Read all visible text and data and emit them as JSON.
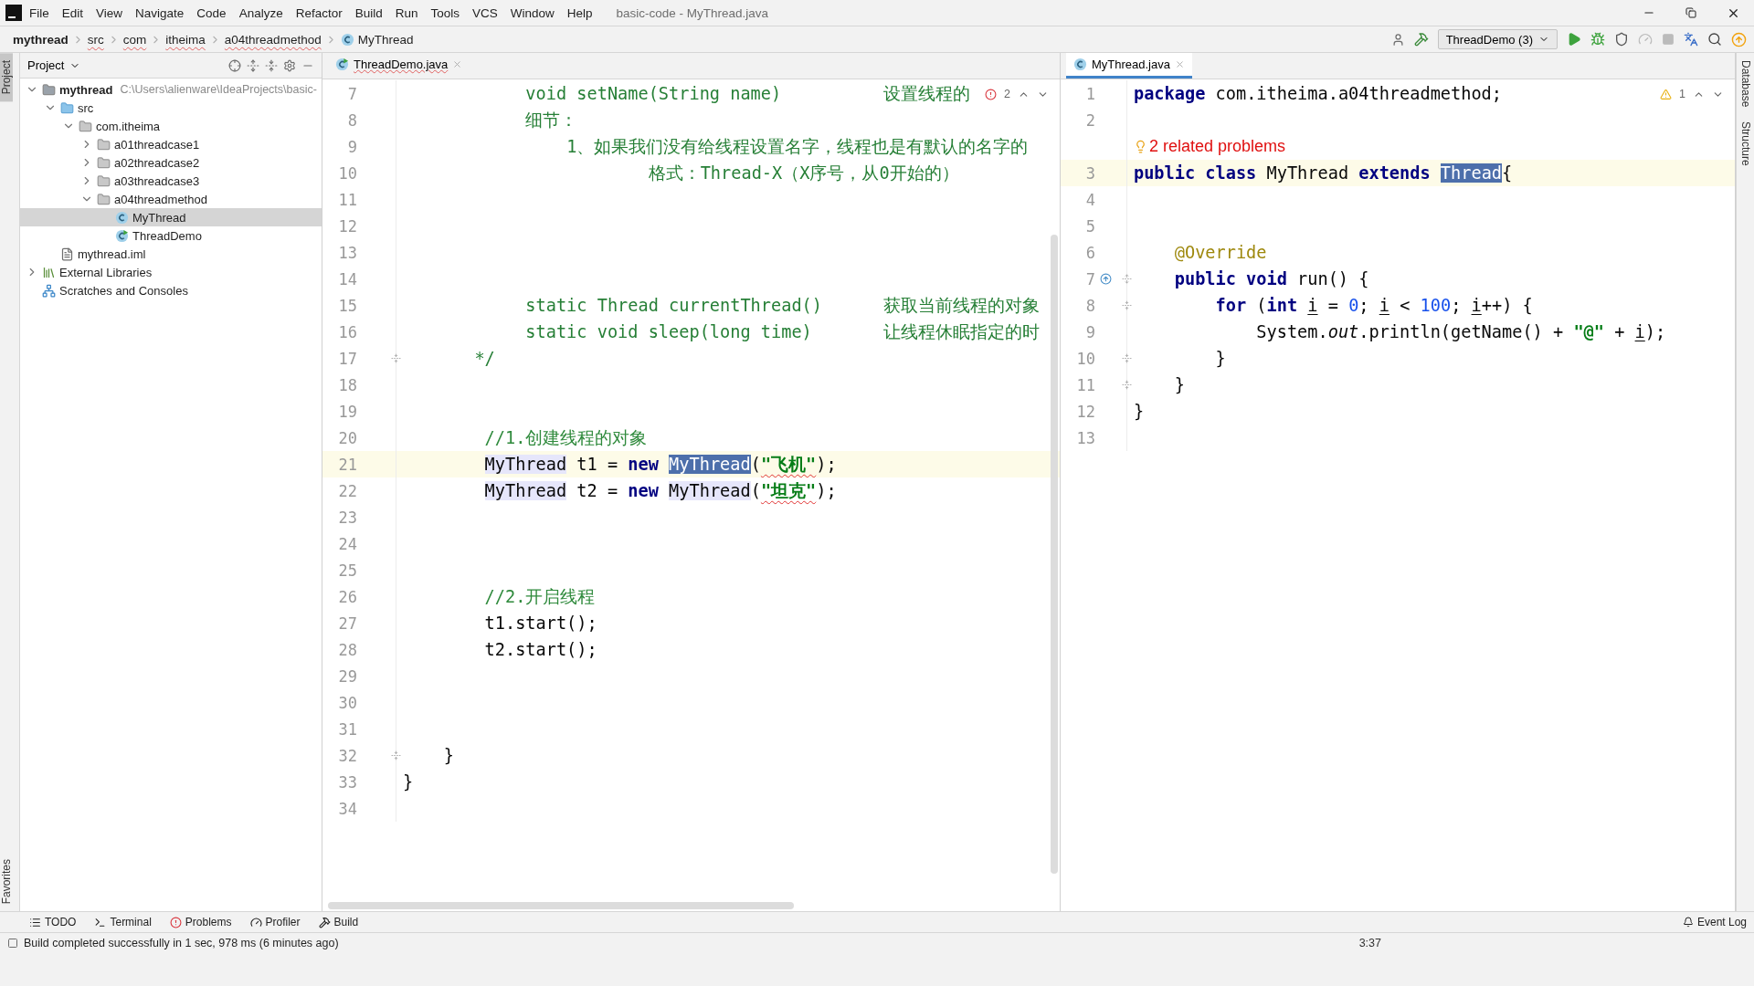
{
  "window": {
    "title": "basic-code - MyThread.java"
  },
  "menu": [
    "File",
    "Edit",
    "View",
    "Navigate",
    "Code",
    "Analyze",
    "Refactor",
    "Build",
    "Run",
    "Tools",
    "VCS",
    "Window",
    "Help"
  ],
  "breadcrumbs": [
    {
      "label": "mythread",
      "kind": "module"
    },
    {
      "label": "src",
      "kind": "folder"
    },
    {
      "label": "com",
      "kind": "folder"
    },
    {
      "label": "itheima",
      "kind": "folder"
    },
    {
      "label": "a04threadmethod",
      "kind": "folder"
    },
    {
      "label": "MyThread",
      "kind": "class"
    }
  ],
  "run_config": "ThreadDemo (3)",
  "left_stripe": [
    {
      "label": "Project",
      "selected": true
    }
  ],
  "left_stripe_bottom": [
    {
      "label": "Favorites",
      "selected": false
    }
  ],
  "right_stripe": [
    {
      "label": "Database",
      "selected": false
    },
    {
      "label": "Structure",
      "selected": false
    }
  ],
  "project_panel": {
    "title": "Project",
    "tree": [
      {
        "label": "mythread",
        "detail": "C:\\Users\\alienware\\IdeaProjects\\basic-",
        "kind": "module",
        "expanded": true,
        "selected": false,
        "children": [
          {
            "label": "src",
            "kind": "source",
            "expanded": true,
            "selected": false,
            "children": [
              {
                "label": "com.itheima",
                "kind": "package",
                "expanded": true,
                "selected": false,
                "children": [
                  {
                    "label": "a01threadcase1",
                    "kind": "package",
                    "expanded": false,
                    "selected": false
                  },
                  {
                    "label": "a02threadcase2",
                    "kind": "package",
                    "expanded": false,
                    "selected": false
                  },
                  {
                    "label": "a03threadcase3",
                    "kind": "package",
                    "expanded": false,
                    "selected": false
                  },
                  {
                    "label": "a04threadmethod",
                    "kind": "package",
                    "expanded": true,
                    "selected": false,
                    "children": [
                      {
                        "label": "MyThread",
                        "kind": "class",
                        "selected": true
                      },
                      {
                        "label": "ThreadDemo",
                        "kind": "runnable",
                        "selected": false
                      }
                    ]
                  }
                ]
              }
            ]
          },
          {
            "label": "mythread.iml",
            "kind": "file",
            "selected": false
          }
        ]
      },
      {
        "label": "External Libraries",
        "kind": "libraries",
        "expanded": false,
        "selected": false
      },
      {
        "label": "Scratches and Consoles",
        "kind": "scratches",
        "selected": false
      }
    ]
  },
  "editors": [
    {
      "tab": {
        "label": "ThreadDemo.java",
        "kind": "runnable",
        "selected": false
      },
      "inspection": {
        "kind": "error",
        "count": "2"
      },
      "scrollbars": true,
      "lines": [
        {
          "number": "7",
          "current": false,
          "segments": [
            {
              "text": "            void setName(String name)          设置线程的",
              "kind": "doc"
            }
          ]
        },
        {
          "number": "8",
          "current": false,
          "segments": [
            {
              "text": "            细节：",
              "kind": "doc"
            }
          ]
        },
        {
          "number": "9",
          "current": false,
          "segments": [
            {
              "text": "                1、如果我们没有给线程设置名字，线程也是有默认的名字的",
              "kind": "doc"
            }
          ]
        },
        {
          "number": "10",
          "current": false,
          "segments": [
            {
              "text": "                        格式：Thread-X（X序号，从0开始的）",
              "kind": "doc"
            }
          ]
        },
        {
          "number": "11",
          "current": false
        },
        {
          "number": "12",
          "current": false
        },
        {
          "number": "13",
          "current": false
        },
        {
          "number": "14",
          "current": false
        },
        {
          "number": "15",
          "current": false,
          "segments": [
            {
              "text": "            static Thread currentThread()      获取当前线程的对象",
              "kind": "doc"
            }
          ]
        },
        {
          "number": "16",
          "current": false,
          "segments": [
            {
              "text": "            static void sleep(long time)       让线程休眠指定的时",
              "kind": "doc"
            }
          ]
        },
        {
          "number": "17",
          "current": false,
          "gutter_icon": {
            "kind": "fold"
          },
          "segments": [
            {
              "text": "       */",
              "kind": "doc"
            }
          ]
        },
        {
          "number": "18",
          "current": false
        },
        {
          "number": "19",
          "current": false
        },
        {
          "number": "20",
          "current": false,
          "segments": [
            {
              "text": "        //1.创建线程的对象",
              "kind": "comment"
            }
          ]
        },
        {
          "number": "21",
          "current": true,
          "segments": [
            {
              "text": "        MyThread",
              "kind": "usage"
            },
            {
              "text": " t1 = ",
              "kind": "plain"
            },
            {
              "text": "new ",
              "kind": "keyword"
            },
            {
              "text": "MyThread",
              "kind": "selection"
            },
            {
              "text": "(",
              "kind": "plain"
            },
            {
              "text": "\"飞机\"",
              "kind": "string-error"
            },
            {
              "text": ");",
              "kind": "plain"
            }
          ]
        },
        {
          "number": "22",
          "current": false,
          "segments": [
            {
              "text": "        MyThread",
              "kind": "usage"
            },
            {
              "text": " t2 = ",
              "kind": "plain"
            },
            {
              "text": "new ",
              "kind": "keyword"
            },
            {
              "text": "MyThread",
              "kind": "usage"
            },
            {
              "text": "(",
              "kind": "plain"
            },
            {
              "text": "\"坦克\"",
              "kind": "string-error"
            },
            {
              "text": ");",
              "kind": "plain"
            }
          ]
        },
        {
          "number": "23",
          "current": false
        },
        {
          "number": "24",
          "current": false
        },
        {
          "number": "25",
          "current": false
        },
        {
          "number": "26",
          "current": false,
          "segments": [
            {
              "text": "        //2.开启线程",
              "kind": "comment"
            }
          ]
        },
        {
          "number": "27",
          "current": false,
          "segments": [
            {
              "text": "        t1.start();",
              "kind": "plain"
            }
          ]
        },
        {
          "number": "28",
          "current": false,
          "segments": [
            {
              "text": "        t2.start();",
              "kind": "plain"
            }
          ]
        },
        {
          "number": "29",
          "current": false
        },
        {
          "number": "30",
          "current": false
        },
        {
          "number": "31",
          "current": false
        },
        {
          "number": "32",
          "current": false,
          "gutter_icon": {
            "kind": "fold"
          },
          "segments": [
            {
              "text": "    }",
              "kind": "plain"
            }
          ]
        },
        {
          "number": "33",
          "current": false,
          "segments": [
            {
              "text": "}",
              "kind": "plain"
            }
          ]
        },
        {
          "number": "34",
          "current": false
        }
      ]
    },
    {
      "tab": {
        "label": "MyThread.java",
        "kind": "class",
        "selected": true
      },
      "inspection": {
        "kind": "warning",
        "count": "1"
      },
      "lines": [
        {
          "number": "1",
          "current": false,
          "segments": [
            {
              "text": "package",
              "kind": "keyword"
            },
            {
              "text": " com.itheima.a04threadmethod;",
              "kind": "plain"
            }
          ]
        },
        {
          "number": "2",
          "current": false
        },
        {
          "inlay": "2 related problems"
        },
        {
          "number": "3",
          "current": true,
          "segments": [
            {
              "text": "public class",
              "kind": "keyword"
            },
            {
              "text": " MyThread ",
              "kind": "plain"
            },
            {
              "text": "extends ",
              "kind": "keyword"
            },
            {
              "text": "Thread",
              "kind": "selection"
            },
            {
              "text": "{",
              "kind": "plain"
            }
          ]
        },
        {
          "number": "4",
          "current": false
        },
        {
          "number": "5",
          "current": false
        },
        {
          "number": "6",
          "current": false,
          "segments": [
            {
              "text": "    @Override",
              "kind": "annotation"
            }
          ]
        },
        {
          "number": "7",
          "current": false,
          "gutter_icon": {
            "kind": "override"
          },
          "segments": [
            {
              "text": "    public void",
              "kind": "keyword"
            },
            {
              "text": " run() {",
              "kind": "plain"
            }
          ]
        },
        {
          "number": "8",
          "current": false,
          "gutter_icon": {
            "kind": "fold"
          },
          "segments": [
            {
              "text": "        for",
              "kind": "keyword"
            },
            {
              "text": " (",
              "kind": "plain"
            },
            {
              "text": "int ",
              "kind": "keyword"
            },
            {
              "text": "i",
              "kind": "reassigned"
            },
            {
              "text": " = ",
              "kind": "plain"
            },
            {
              "text": "0",
              "kind": "number"
            },
            {
              "text": "; ",
              "kind": "plain"
            },
            {
              "text": "i",
              "kind": "reassigned"
            },
            {
              "text": " < ",
              "kind": "plain"
            },
            {
              "text": "100",
              "kind": "number"
            },
            {
              "text": "; ",
              "kind": "plain"
            },
            {
              "text": "i",
              "kind": "reassigned"
            },
            {
              "text": "++) {",
              "kind": "plain"
            }
          ]
        },
        {
          "number": "9",
          "current": false,
          "segments": [
            {
              "text": "            System.",
              "kind": "plain"
            },
            {
              "text": "out",
              "kind": "static-field"
            },
            {
              "text": ".println(getName() + ",
              "kind": "plain"
            },
            {
              "text": "\"@\"",
              "kind": "string"
            },
            {
              "text": " + ",
              "kind": "plain"
            },
            {
              "text": "i",
              "kind": "reassigned"
            },
            {
              "text": ");",
              "kind": "plain"
            }
          ]
        },
        {
          "number": "10",
          "current": false,
          "gutter_icon": {
            "kind": "fold"
          },
          "segments": [
            {
              "text": "        }",
              "kind": "plain"
            }
          ]
        },
        {
          "number": "11",
          "current": false,
          "gutter_icon": {
            "kind": "fold"
          },
          "segments": [
            {
              "text": "    }",
              "kind": "plain"
            }
          ]
        },
        {
          "number": "12",
          "current": false,
          "segments": [
            {
              "text": "}",
              "kind": "plain"
            }
          ]
        },
        {
          "number": "13",
          "current": false
        }
      ]
    }
  ],
  "tool_windows": [
    {
      "label": "TODO",
      "kind": "todo"
    },
    {
      "label": "Terminal",
      "kind": "terminal"
    },
    {
      "label": "Problems",
      "kind": "problems"
    },
    {
      "label": "Profiler",
      "kind": "profiler"
    },
    {
      "label": "Build",
      "kind": "build"
    }
  ],
  "event_log": "Event Log",
  "status_bar": {
    "message": "Build completed successfully in 1 sec, 978 ms (6 minutes ago)",
    "caret": "3:37"
  }
}
